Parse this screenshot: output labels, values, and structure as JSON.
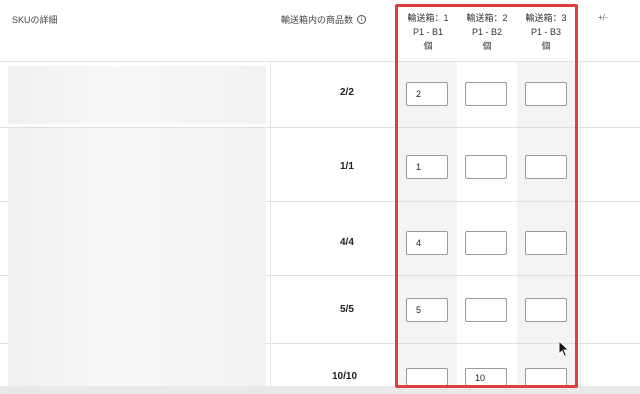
{
  "header": {
    "sku_details": "SKUの詳細",
    "qty_in_box": "輸送箱内の商品数",
    "info_icon": "info-circle-icon",
    "plus_minus": "+/-",
    "boxes": [
      {
        "line1": "輸送箱：1",
        "line2": "P1 - B1",
        "line3": "個"
      },
      {
        "line1": "輸送箱：2",
        "line2": "P1 - B2",
        "line3": "個"
      },
      {
        "line1": "輸送箱：3",
        "line2": "P1 - B3",
        "line3": "個"
      }
    ]
  },
  "rows": [
    {
      "qty": "2/2",
      "inputs": [
        "2",
        "",
        ""
      ]
    },
    {
      "qty": "1/1",
      "inputs": [
        "1",
        "",
        ""
      ]
    },
    {
      "qty": "4/4",
      "inputs": [
        "4",
        "",
        ""
      ]
    },
    {
      "qty": "5/5",
      "inputs": [
        "5",
        "",
        ""
      ]
    },
    {
      "qty": "10/10",
      "inputs": [
        "",
        "10",
        ""
      ]
    }
  ],
  "colors": {
    "highlight": "#d9433b",
    "row_border": "#e0e0e0"
  },
  "cursor_icon": "mouse-pointer-icon"
}
